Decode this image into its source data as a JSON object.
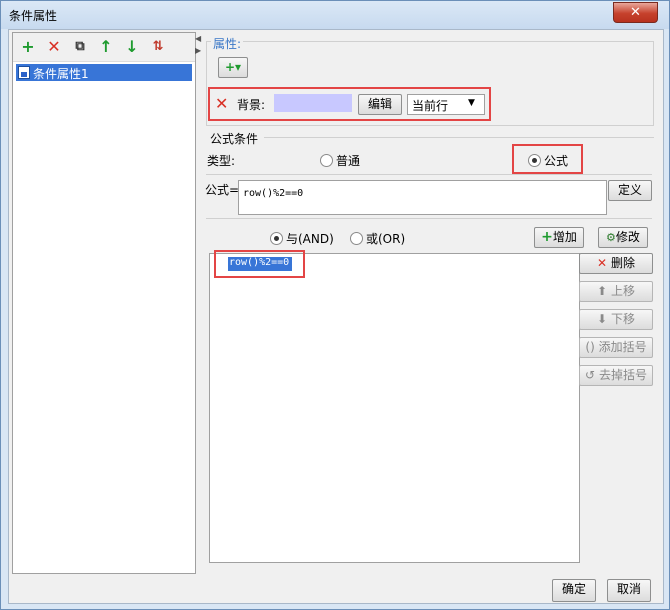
{
  "window": {
    "title": "条件属性",
    "close": "✕"
  },
  "toolbar": {
    "add": "+",
    "delete": "✕",
    "copy": "⧉",
    "up": "↑",
    "down": "↓",
    "sort": "⇅"
  },
  "tree": {
    "items": [
      {
        "label": "条件属性1"
      }
    ]
  },
  "properties": {
    "group_title": "属性:",
    "add_menu": "+▾",
    "background_label": "背景:",
    "edit_button": "编辑",
    "scope_value": "当前行",
    "dropdown_arrow": "▼"
  },
  "formula_condition": {
    "group_title": "公式条件",
    "type_label": "类型:",
    "radio_normal": "普通",
    "radio_formula": "公式",
    "formula_label": "公式=",
    "formula_value": "row()%2==0",
    "define_button": "定义",
    "and_label": "与(AND)",
    "or_label": "或(OR)",
    "add_button": "增加",
    "modify_button": "修改",
    "conditions": [
      "row()%2==0"
    ],
    "delete_button": "删除",
    "move_up_button": "上移",
    "move_down_button": "下移",
    "add_bracket_button": "添加括号",
    "remove_bracket_button": "去掉括号"
  },
  "footer": {
    "ok": "确定",
    "cancel": "取消"
  },
  "colors": {
    "background_swatch": "#c8c8ff",
    "highlight": "#e34545",
    "selection": "#3875d7"
  }
}
